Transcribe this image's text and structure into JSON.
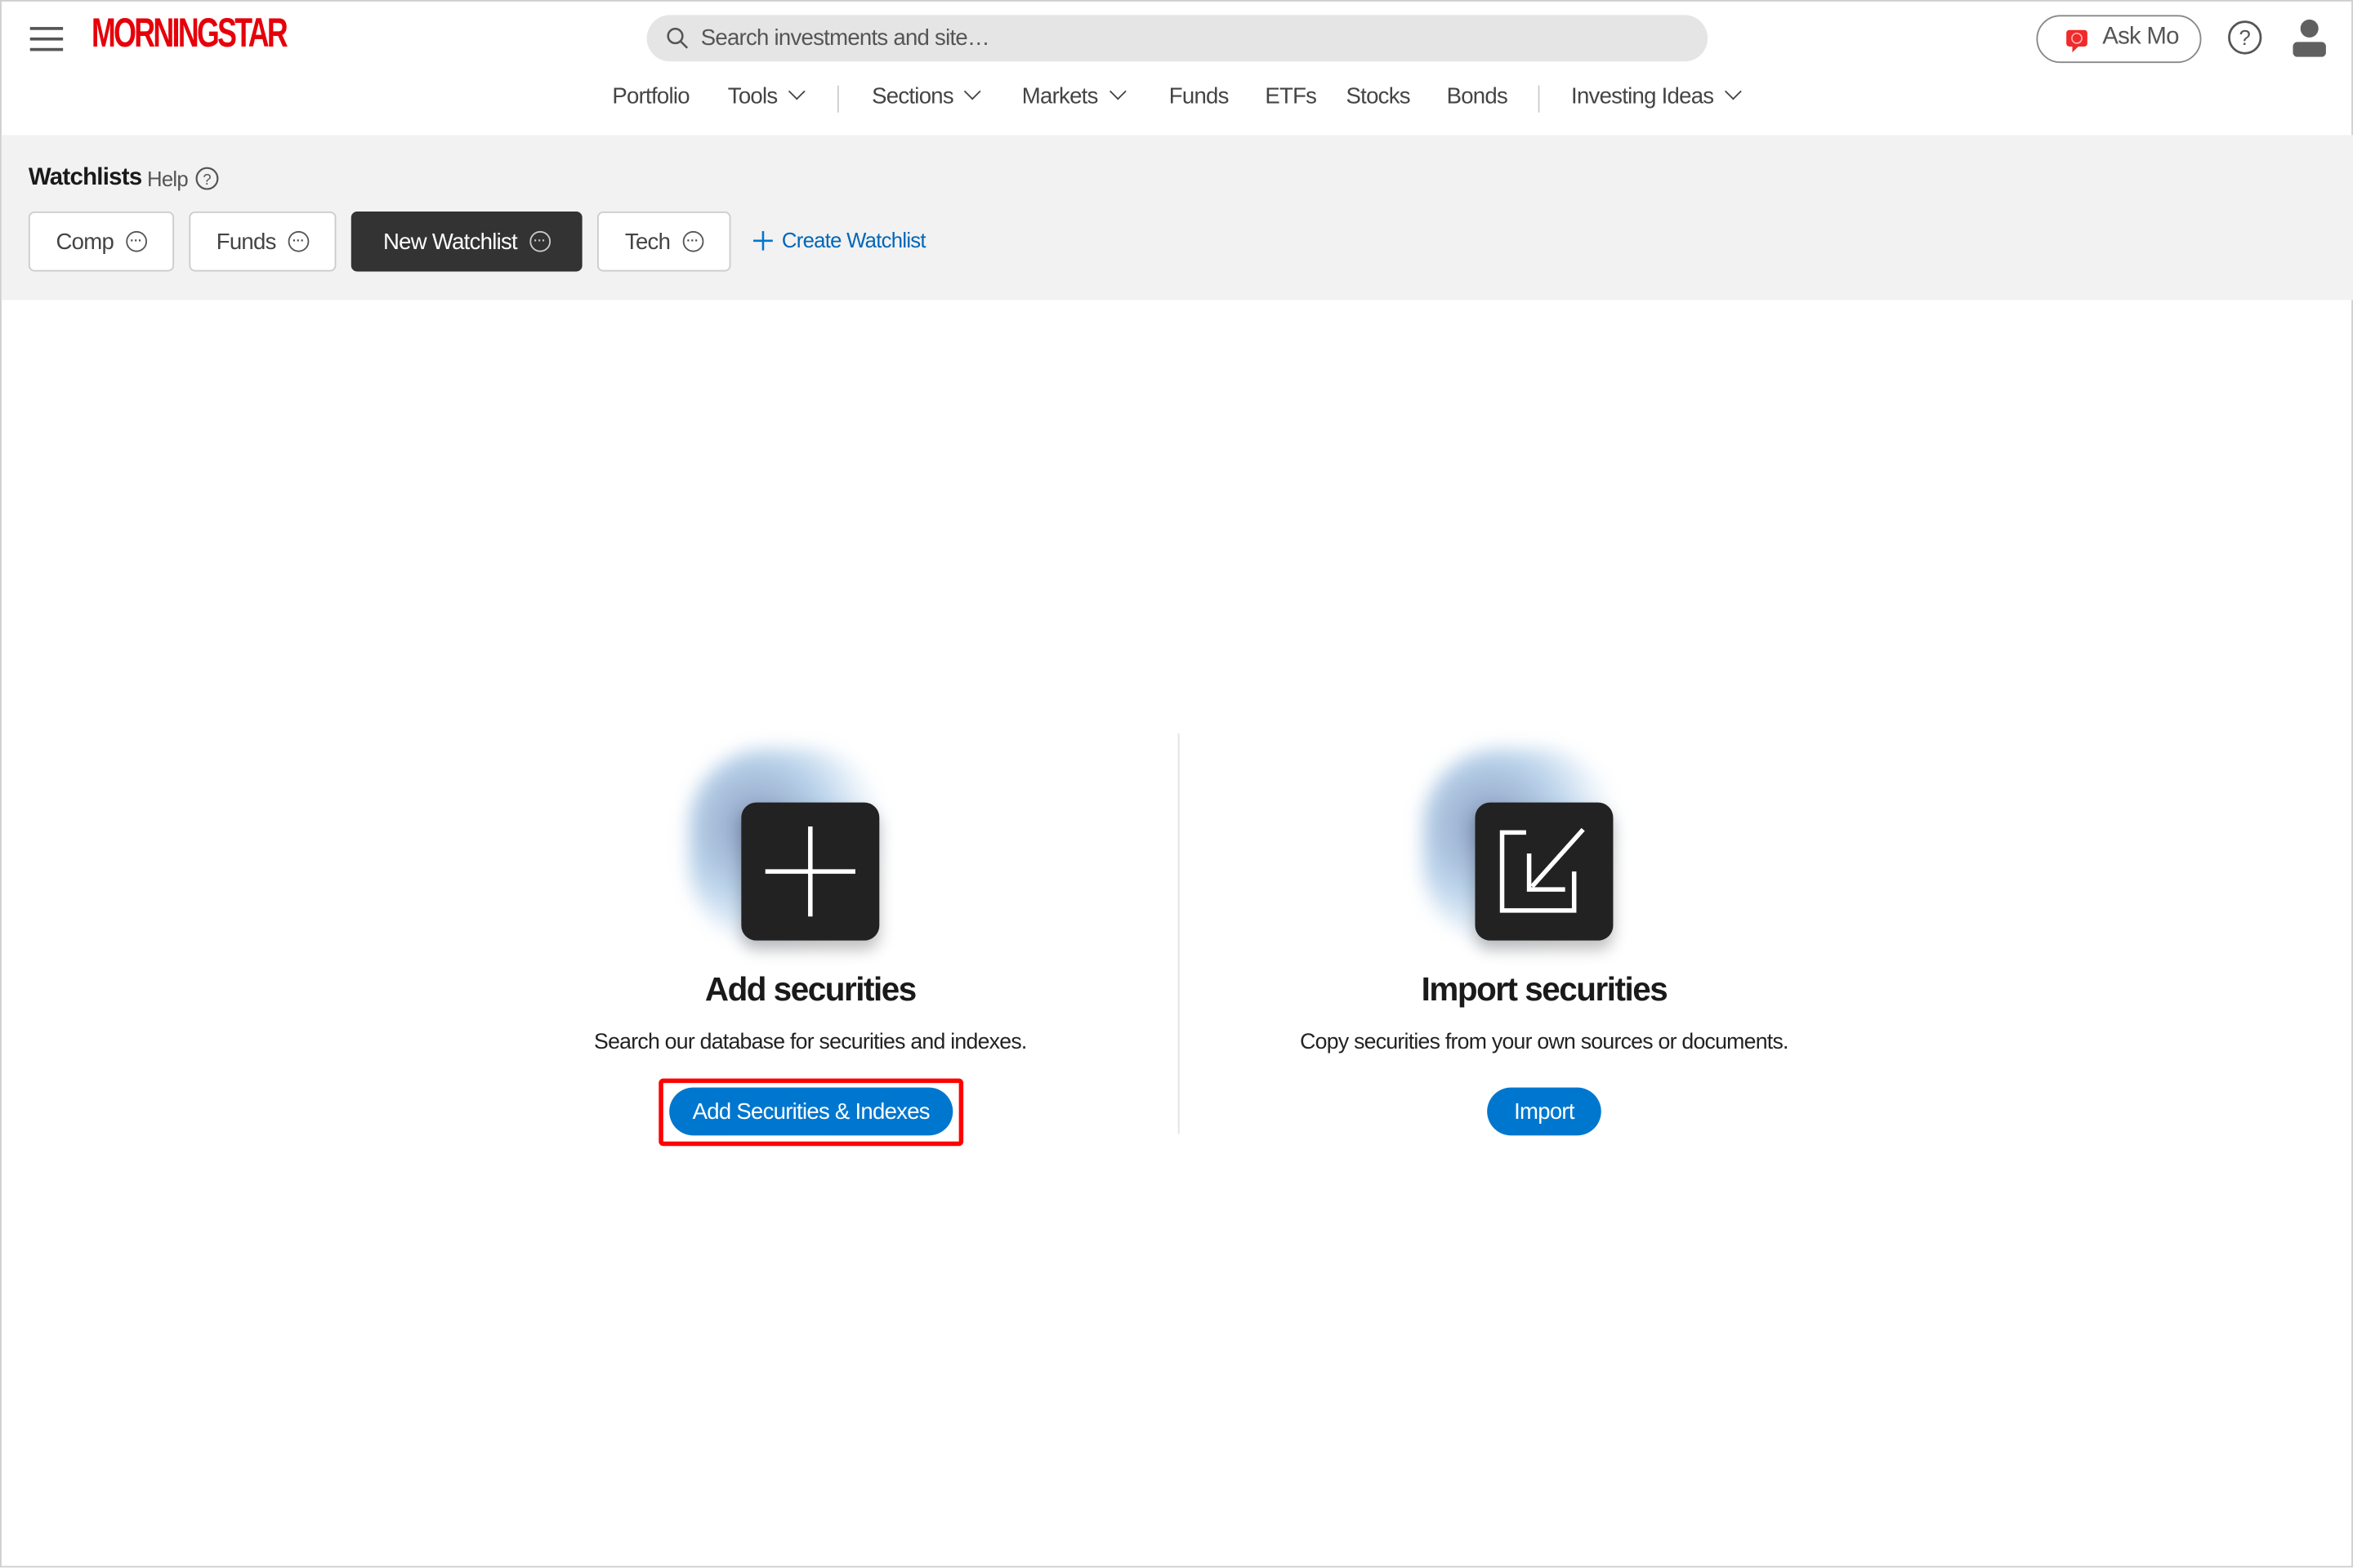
{
  "header": {
    "logo": "MORNINGSTAR",
    "search_placeholder": "Search investments and site…",
    "ask_mo": "Ask Mo",
    "nav": [
      {
        "label": "Portfolio",
        "dropdown": false
      },
      {
        "label": "Tools",
        "dropdown": true
      },
      {
        "label": "Sections",
        "dropdown": true
      },
      {
        "label": "Markets",
        "dropdown": true
      },
      {
        "label": "Funds",
        "dropdown": false
      },
      {
        "label": "ETFs",
        "dropdown": false
      },
      {
        "label": "Stocks",
        "dropdown": false
      },
      {
        "label": "Bonds",
        "dropdown": false
      },
      {
        "label": "Investing Ideas",
        "dropdown": true
      }
    ]
  },
  "watchlists": {
    "title": "Watchlists",
    "help": "Help",
    "tabs": [
      {
        "label": "Comp",
        "active": false
      },
      {
        "label": "Funds",
        "active": false
      },
      {
        "label": "New Watchlist",
        "active": true
      },
      {
        "label": "Tech",
        "active": false
      }
    ],
    "create": "Create Watchlist"
  },
  "cards": {
    "add": {
      "title": "Add securities",
      "description": "Search our database for securities and indexes.",
      "button": "Add Securities & Indexes",
      "icon": "plus-icon"
    },
    "import": {
      "title": "Import securities",
      "description": "Copy securities from your own sources or documents.",
      "button": "Import",
      "icon": "import-arrow-icon"
    }
  },
  "colors": {
    "brand": "#e5000a",
    "accent": "#0077cf",
    "highlight": "#ff0000",
    "active_tab": "#333333"
  }
}
